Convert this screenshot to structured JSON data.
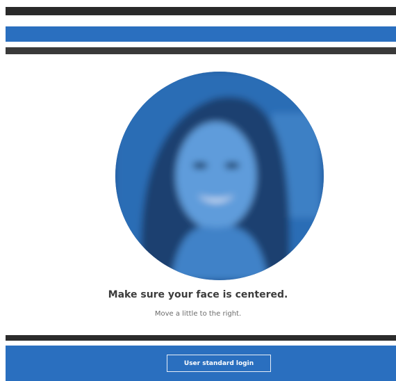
{
  "prompt": {
    "title": "Make sure your face is centered.",
    "hint": "Move a little to the right."
  },
  "actions": {
    "standard_login_label": "User standard login"
  },
  "colors": {
    "accent_blue": "#2a6fbf",
    "dark_stripe": "#2a2a2a",
    "background": "#ffffff"
  }
}
